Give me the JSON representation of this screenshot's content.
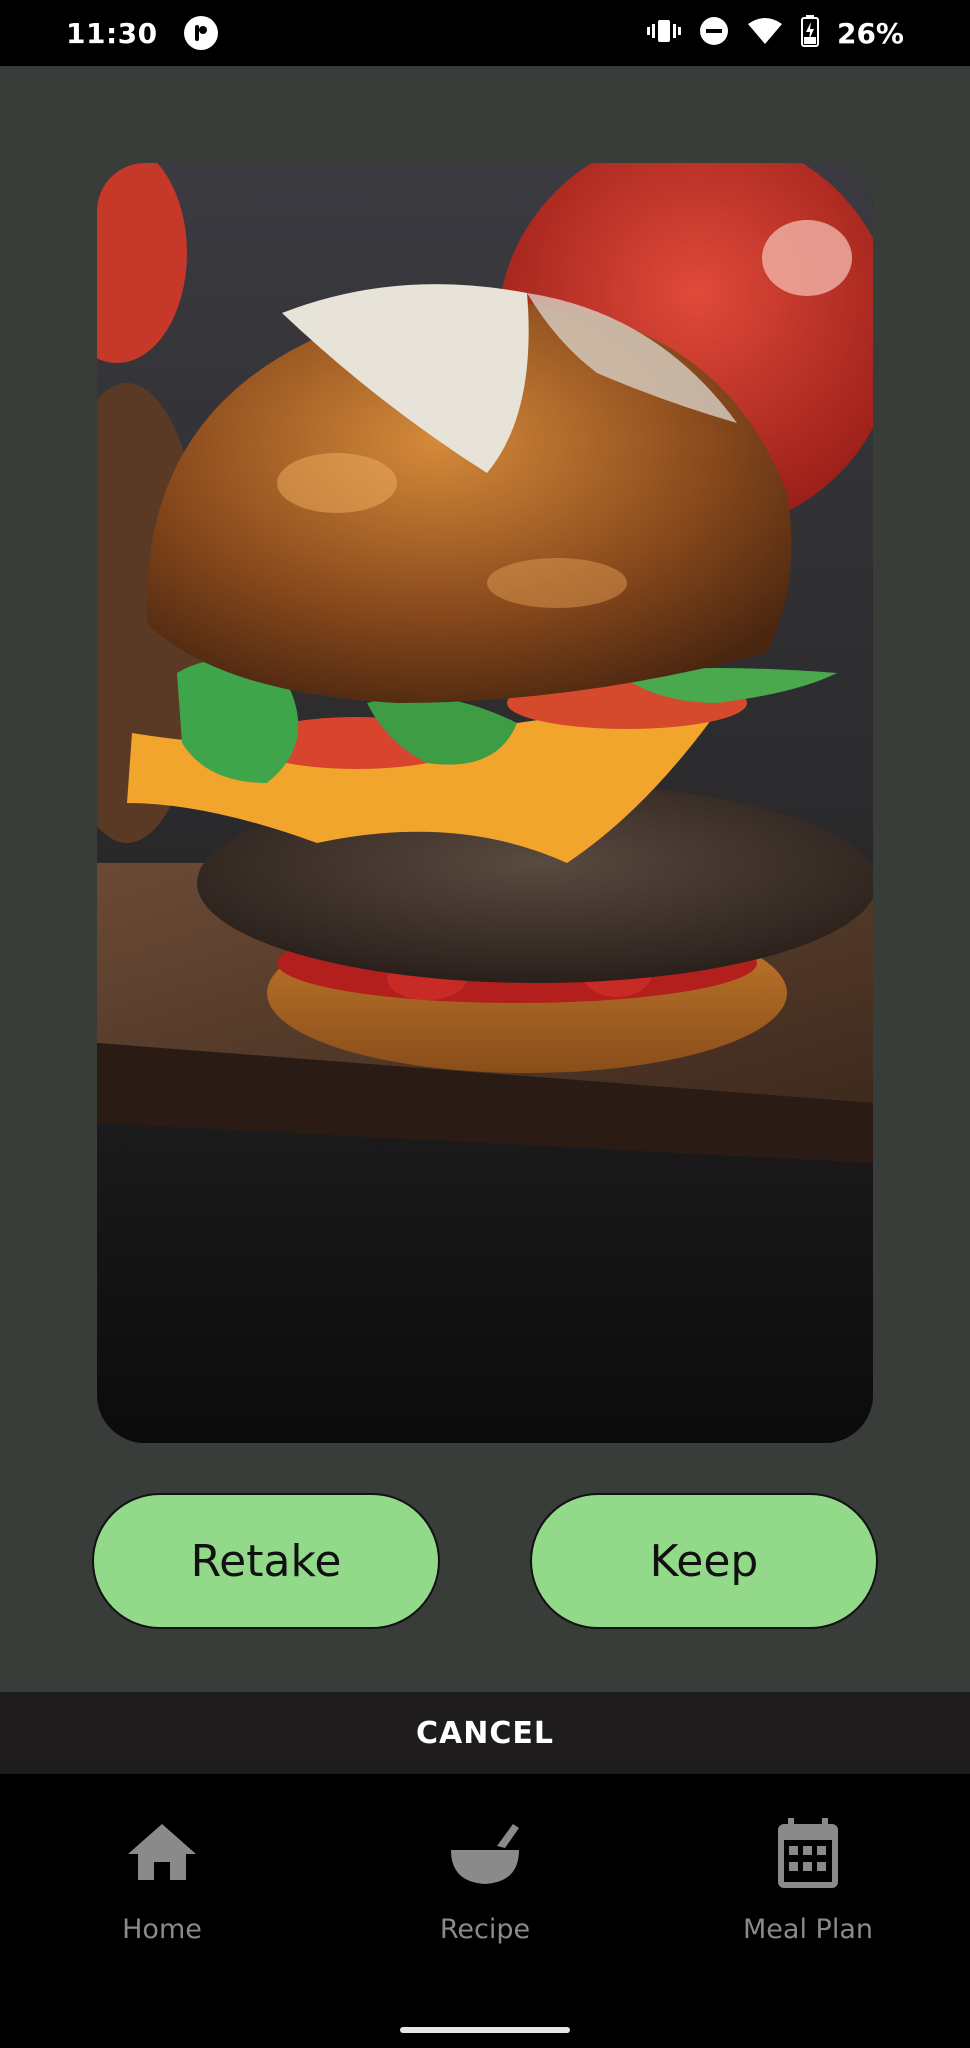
{
  "status_bar": {
    "time": "11:30",
    "battery": "26%",
    "icons": [
      "app-notification-icon",
      "vibrate-icon",
      "do-not-disturb-icon",
      "wifi-icon",
      "battery-charging-icon"
    ]
  },
  "photo_preview": {
    "subject_icon": "burger-photo"
  },
  "actions": {
    "retake_label": "Retake",
    "keep_label": "Keep"
  },
  "cancel_label": "CANCEL",
  "bottom_nav": {
    "items": [
      {
        "label": "Home",
        "icon": "home-icon"
      },
      {
        "label": "Recipe",
        "icon": "mortar-pestle-icon"
      },
      {
        "label": "Meal Plan",
        "icon": "calendar-icon"
      }
    ]
  },
  "colors": {
    "background": "#383d39",
    "button": "#92d98a",
    "cancel_bar": "#1e1c1d",
    "nav_inactive": "#8a8a8a"
  }
}
